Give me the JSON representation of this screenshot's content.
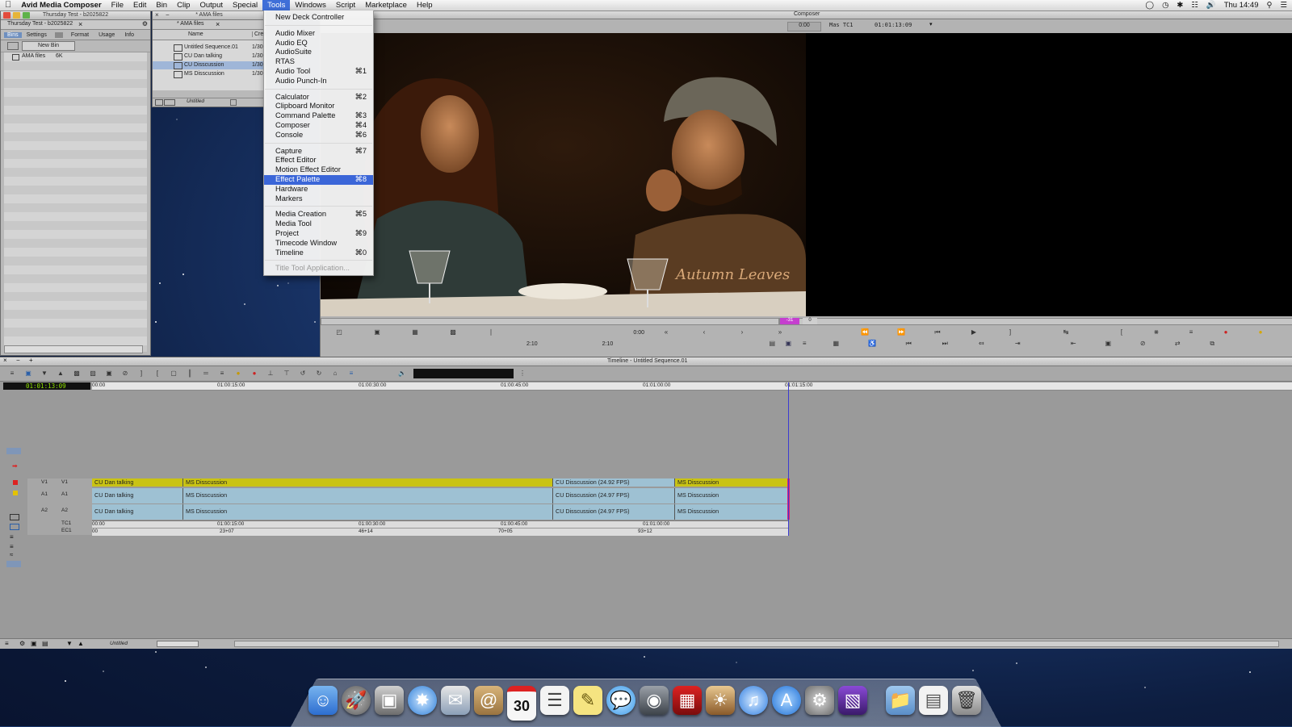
{
  "menubar": {
    "app_name": "Avid Media Composer",
    "items": [
      "File",
      "Edit",
      "Bin",
      "Clip",
      "Output",
      "Special",
      "Tools",
      "Windows",
      "Script",
      "Marketplace",
      "Help"
    ],
    "active_item": "Tools",
    "clock": "Thu 14:49"
  },
  "project_window": {
    "title": "Thursday Test - b2025822",
    "tab_label": "Thursday Test - b2025822",
    "tabs": [
      "Bins",
      "Settings",
      "Format",
      "Usage",
      "Info"
    ],
    "new_bin_label": "New Bin",
    "bins": [
      {
        "name": "AMA files",
        "size": "6K"
      }
    ]
  },
  "bin_window": {
    "title": "* AMA files",
    "tab_label": "* AMA files",
    "columns": [
      "Name",
      "Crea"
    ],
    "rows": [
      {
        "name": "Untitled Sequence.01",
        "created": "1/30"
      },
      {
        "name": "CU Dan talking",
        "created": "1/30"
      },
      {
        "name": "CU Disscussion",
        "created": "1/30"
      },
      {
        "name": "MS Disscussion",
        "created": "1/30"
      }
    ],
    "footer_label": "Untitled"
  },
  "tools_menu": {
    "groups": [
      [
        {
          "label": "New Deck Controller",
          "shortcut": ""
        }
      ],
      [
        {
          "label": "Audio Mixer",
          "shortcut": ""
        },
        {
          "label": "Audio EQ",
          "shortcut": ""
        },
        {
          "label": "AudioSuite",
          "shortcut": ""
        },
        {
          "label": "RTAS",
          "shortcut": ""
        },
        {
          "label": "Audio Tool",
          "shortcut": "⌘1"
        },
        {
          "label": "Audio Punch-In",
          "shortcut": ""
        }
      ],
      [
        {
          "label": "Calculator",
          "shortcut": "⌘2"
        },
        {
          "label": "Clipboard Monitor",
          "shortcut": ""
        },
        {
          "label": "Command Palette",
          "shortcut": "⌘3"
        },
        {
          "label": "Composer",
          "shortcut": "⌘4"
        },
        {
          "label": "Console",
          "shortcut": "⌘6"
        }
      ],
      [
        {
          "label": "Capture",
          "shortcut": "⌘7"
        },
        {
          "label": "Effect Editor",
          "shortcut": ""
        },
        {
          "label": "Motion Effect Editor",
          "shortcut": ""
        },
        {
          "label": "Effect Palette",
          "shortcut": "⌘8",
          "highlighted": true
        },
        {
          "label": "Hardware",
          "shortcut": ""
        },
        {
          "label": "Markers",
          "shortcut": ""
        }
      ],
      [
        {
          "label": "Media Creation",
          "shortcut": "⌘5"
        },
        {
          "label": "Media Tool",
          "shortcut": ""
        },
        {
          "label": "Project",
          "shortcut": "⌘9"
        },
        {
          "label": "Timecode Window",
          "shortcut": ""
        },
        {
          "label": "Timeline",
          "shortcut": "⌘0"
        }
      ],
      [
        {
          "label": "Title Tool Application...",
          "shortcut": "",
          "disabled": true
        }
      ]
    ]
  },
  "composer": {
    "title": "Composer",
    "left_counter": "0:00",
    "tc_label": "Mas TC1",
    "tc_value": "01:01:13:09",
    "source_time": "0:00",
    "duration_left": "2:10",
    "duration_right": "2:10",
    "marker_left": "-31",
    "marker_right": "0",
    "shirt_text": "Autumn Leaves"
  },
  "timeline": {
    "title": "Timeline - Untitled Sequence.01",
    "timecode": "01:01:13:09",
    "ruler": [
      "00:00",
      "01:00:15:00",
      "01:00:30:00",
      "01:00:45:00",
      "01:01:00:00",
      "01:01:15:00"
    ],
    "tracks": {
      "v1_left": "V1",
      "v1_right": "V1",
      "a1_left": "A1",
      "a1_right": "A1",
      "a2_left": "A2",
      "a2_right": "A2",
      "tc1": "TC1",
      "ec1": "EC1"
    },
    "video_clips": [
      "CU Dan talking",
      "MS Disscussion",
      "CU Disscussion (24.92 FPS)",
      "MS Disscussion"
    ],
    "audio_clips": [
      "CU Dan talking",
      "MS Disscussion",
      "CU Disscussion (24.97 FPS)",
      "MS Disscussion"
    ],
    "tc_marks": [
      "00:00",
      "01:00:15:00",
      "01:00:30:00",
      "01:00:45:00",
      "01:01:00:00"
    ],
    "ec_marks": [
      "00",
      "23+07",
      "46+14",
      "70+05",
      "93+12"
    ],
    "footer_label": "Untitled"
  },
  "dock": {
    "icons": [
      "finder-icon",
      "launchpad-icon",
      "photo-browser-icon",
      "safari-icon",
      "mail-icon",
      "contacts-icon",
      "calendar-icon",
      "reminders-icon",
      "notes-icon",
      "messages-icon",
      "facetime-icon",
      "photo-booth-icon",
      "iphoto-icon",
      "itunes-icon",
      "app-store-icon",
      "system-preferences-icon",
      "avid-media-composer-icon",
      "folder-icon",
      "document-icon",
      "trash-icon"
    ],
    "calendar_day": "30"
  },
  "colors": {
    "menu_highlight": "#3b66d8",
    "video_clip": "#c9c314",
    "audio_clip": "#9ec1d3",
    "timecode_green": "#8ee000"
  }
}
